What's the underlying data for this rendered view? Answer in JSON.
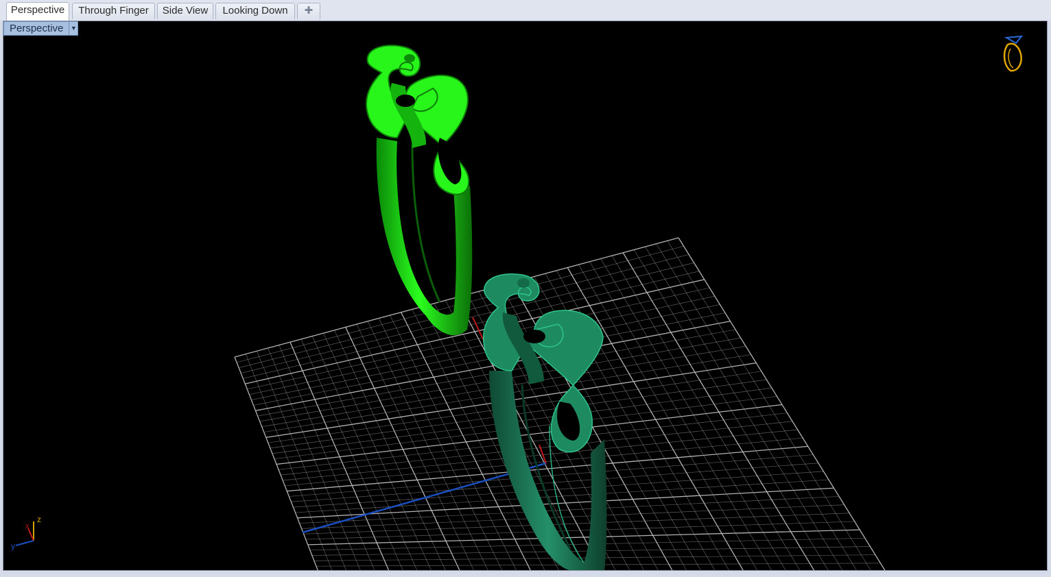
{
  "tabs": [
    {
      "label": "Perspective",
      "active": true
    },
    {
      "label": "Through Finger",
      "active": false
    },
    {
      "label": "Side View",
      "active": false
    },
    {
      "label": "Looking Down",
      "active": false
    }
  ],
  "add_tab_icon": "plus-icon",
  "viewport": {
    "label": "Perspective",
    "dropdown_icon": "triangle-down-icon",
    "background": "#000000",
    "grid_color": "#9a9a9a",
    "x_axis_color": "#c01818",
    "y_axis_color": "#1a4fc0"
  },
  "axis_widget": {
    "z_label": "z",
    "y_label": "y",
    "x_label": "x"
  },
  "objects": [
    {
      "name": "treble-clef-ring-selected",
      "color": "#1ee810"
    },
    {
      "name": "treble-clef-ring",
      "color": "#1a7a55"
    }
  ],
  "corner_icon": "rhino-logo-icon"
}
